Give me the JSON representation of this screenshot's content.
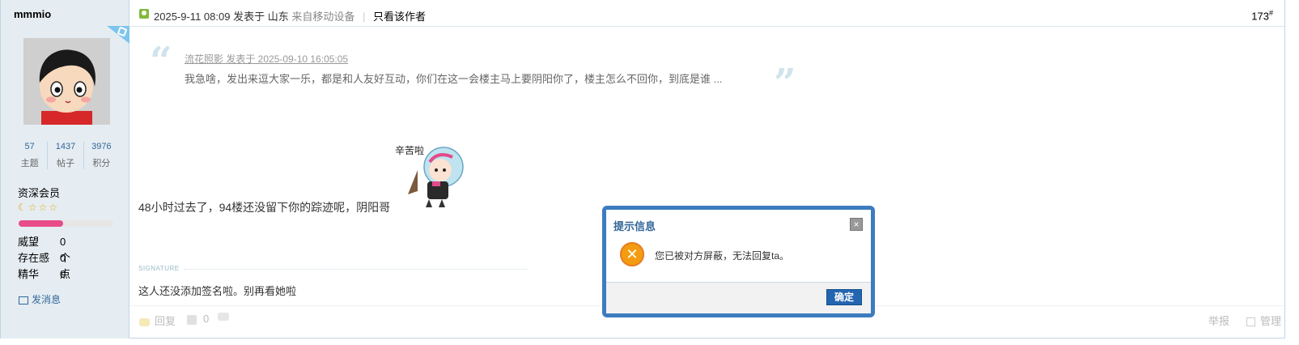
{
  "author": {
    "name": "mmmio",
    "stats": [
      {
        "value": "57",
        "label": "主题"
      },
      {
        "value": "1437",
        "label": "帖子"
      },
      {
        "value": "3976",
        "label": "积分"
      }
    ],
    "group": "资深会员",
    "level_progress": 0.47,
    "fields": [
      {
        "label": "威望",
        "value": "0 个"
      },
      {
        "label": "存在感",
        "value": "0 点"
      },
      {
        "label": "精华",
        "value": "0"
      }
    ],
    "send_message": "发消息"
  },
  "post": {
    "timestamp": "2025-9-11 08:09",
    "posted_in": "发表于 山东",
    "device": "来自移动设备",
    "only_author": "只看该作者",
    "floor": "173",
    "floor_suffix": "#",
    "quote_header": "流花照影 发表于 2025-09-10 16:05:05",
    "quote_text": "我急啥，发出来逗大家一乐，都是和人友好互动，你们在这一会楼主马上要阴阳你了，楼主怎么不回你，到底是谁 ...",
    "content": "48小时过去了，94楼还没留下你的踪迹呢，阴阳哥",
    "sticker_text": "辛苦啦",
    "signature_label": "SIGNATURE",
    "signature": "这人还没添加签名啦。别再看她啦"
  },
  "footer": {
    "reply": "回复",
    "likes": "0",
    "report": "举报",
    "manage": "管理"
  },
  "dialog": {
    "title": "提示信息",
    "message": "您已被对方屏蔽，无法回复ta。",
    "ok": "确定",
    "close": "×"
  },
  "colors": {
    "sidebar_bg": "#e5edf2",
    "link": "#336699",
    "dialog_border": "#3c7cbf",
    "ok_button": "#2365b0",
    "warn_icon": "#f39c12"
  }
}
